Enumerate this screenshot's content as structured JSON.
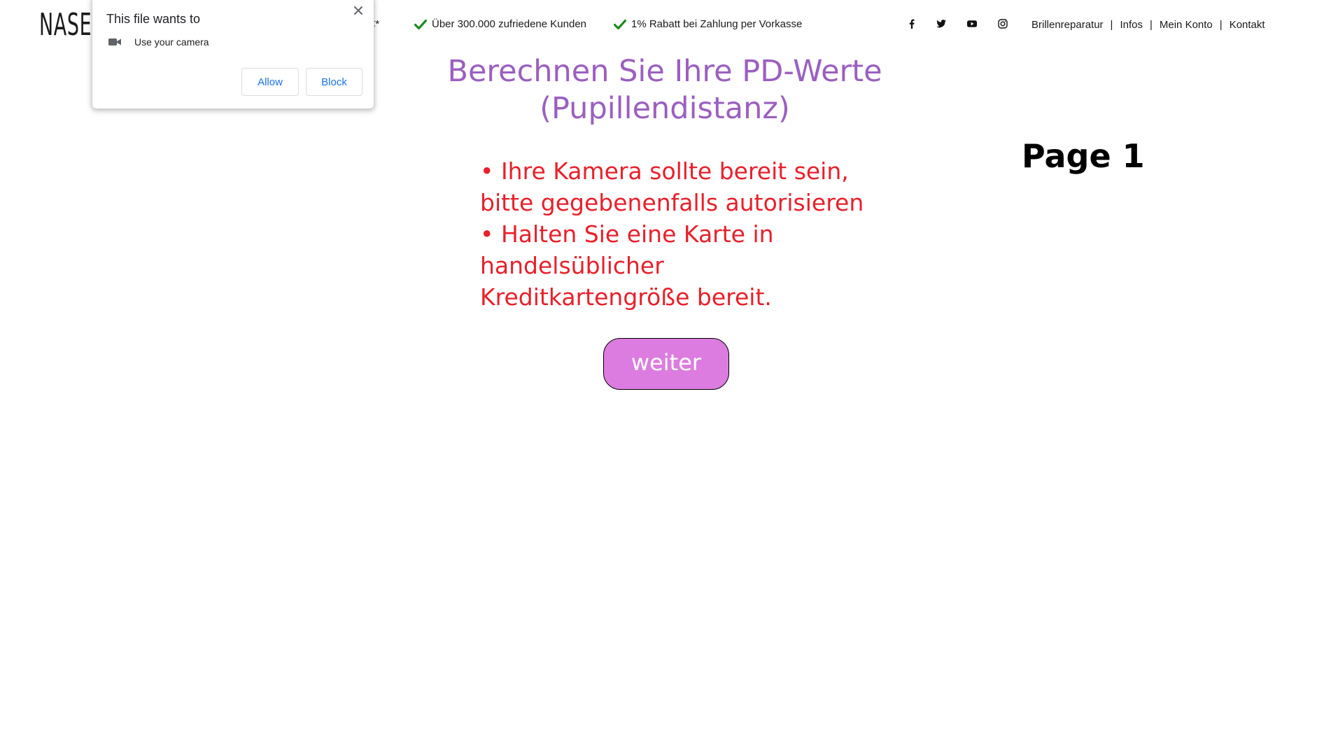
{
  "header": {
    "logo_text": "NASE",
    "usp_partial": "€*",
    "usp_items": [
      "Über 300.000 zufriedene Kunden",
      "1% Rabatt bei Zahlung per Vorkasse"
    ],
    "social_icons": [
      "facebook-icon",
      "twitter-icon",
      "youtube-icon",
      "instagram-icon"
    ],
    "nav_links": [
      "Brillenreparatur",
      "Infos",
      "Mein Konto",
      "Kontakt"
    ],
    "nav_separator": "|"
  },
  "main": {
    "headline_line1": "Berechnen Sie Ihre PD-Werte",
    "headline_line2": "(Pupillendistanz)",
    "page_label": "Page 1",
    "instruction_1": "• Ihre Kamera sollte bereit sein, bitte gegebenenfalls autorisieren",
    "instruction_2": "• Halten Sie eine Karte in handelsüblicher Kreditkartengröße bereit.",
    "button_label": "weiter"
  },
  "permission_popup": {
    "title": "This file wants to",
    "permission": "Use your camera",
    "allow_label": "Allow",
    "block_label": "Block"
  },
  "colors": {
    "headline": "#9b5fc0",
    "instructions": "#e8202a",
    "button_bg": "#dc7ce0",
    "check": "#1e8a1e",
    "popup_button_text": "#1a73e8"
  }
}
